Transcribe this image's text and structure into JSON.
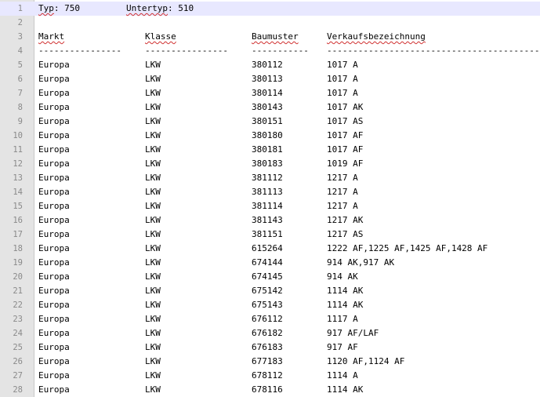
{
  "header_line": {
    "typ_label": "Typ",
    "typ_value": ": 750",
    "untertyp_label": "Untertyp",
    "untertyp_value": ": 510"
  },
  "columns": [
    "Markt",
    "Klasse",
    "Baumuster",
    "Verkaufsbezeichnung"
  ],
  "separators": [
    "----------------",
    "----------------",
    "-----------",
    "-------------------------------------------"
  ],
  "line_numbers": [
    "1",
    "2",
    "3",
    "4",
    "5",
    "6",
    "7",
    "8",
    "9",
    "10",
    "11",
    "12",
    "13",
    "14",
    "15",
    "16",
    "17",
    "18",
    "19",
    "20",
    "21",
    "22",
    "23",
    "24",
    "25",
    "26",
    "27",
    "28"
  ],
  "rows": [
    [
      "Europa",
      "LKW",
      "380112",
      "1017 A"
    ],
    [
      "Europa",
      "LKW",
      "380113",
      "1017 A"
    ],
    [
      "Europa",
      "LKW",
      "380114",
      "1017 A"
    ],
    [
      "Europa",
      "LKW",
      "380143",
      "1017 AK"
    ],
    [
      "Europa",
      "LKW",
      "380151",
      "1017 AS"
    ],
    [
      "Europa",
      "LKW",
      "380180",
      "1017 AF"
    ],
    [
      "Europa",
      "LKW",
      "380181",
      "1017 AF"
    ],
    [
      "Europa",
      "LKW",
      "380183",
      "1019 AF"
    ],
    [
      "Europa",
      "LKW",
      "381112",
      "1217 A"
    ],
    [
      "Europa",
      "LKW",
      "381113",
      "1217 A"
    ],
    [
      "Europa",
      "LKW",
      "381114",
      "1217 A"
    ],
    [
      "Europa",
      "LKW",
      "381143",
      "1217 AK"
    ],
    [
      "Europa",
      "LKW",
      "381151",
      "1217 AS"
    ],
    [
      "Europa",
      "LKW",
      "615264",
      "1222 AF,1225 AF,1425 AF,1428 AF"
    ],
    [
      "Europa",
      "LKW",
      "674144",
      "914 AK,917 AK"
    ],
    [
      "Europa",
      "LKW",
      "674145",
      "914 AK"
    ],
    [
      "Europa",
      "LKW",
      "675142",
      "1114 AK"
    ],
    [
      "Europa",
      "LKW",
      "675143",
      "1114 AK"
    ],
    [
      "Europa",
      "LKW",
      "676112",
      "1117 A"
    ],
    [
      "Europa",
      "LKW",
      "676182",
      "917 AF/LAF"
    ],
    [
      "Europa",
      "LKW",
      "676183",
      "917 AF"
    ],
    [
      "Europa",
      "LKW",
      "677183",
      "1120 AF,1124 AF"
    ],
    [
      "Europa",
      "LKW",
      "678112",
      "1114 A"
    ],
    [
      "Europa",
      "LKW",
      "678116",
      "1114 AK"
    ]
  ],
  "colors": {
    "gutter_bg": "#e4e4e4",
    "current_line_bg": "#e8e8ff",
    "line_number": "#8a8a8a",
    "spell_underline": "#d03030"
  }
}
